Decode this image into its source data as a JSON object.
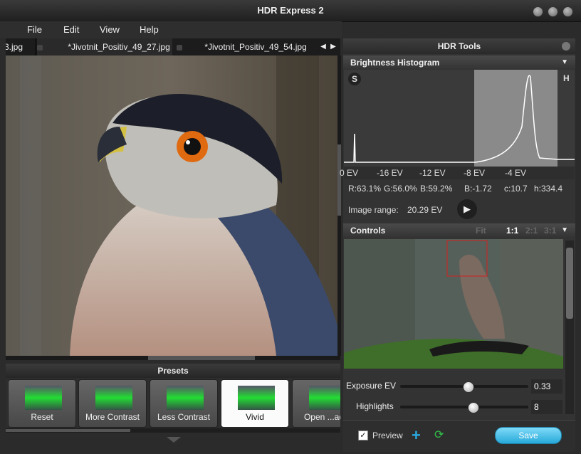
{
  "window": {
    "title": "HDR Express 2"
  },
  "menu": [
    "File",
    "Edit",
    "View",
    "Help"
  ],
  "tabs": [
    "3.jpg",
    "*Jivotnit_Positiv_49_27.jpg",
    "*Jivotnit_Positiv_49_54.jpg"
  ],
  "presets": {
    "header": "Presets",
    "items": [
      "Reset",
      "More Contrast",
      "Less Contrast",
      "Vivid",
      "Open ...adc"
    ],
    "selected": "Vivid"
  },
  "panel": {
    "title": "HDR Tools",
    "histogram": {
      "title": "Brightness Histogram",
      "s_label": "S",
      "h_label": "H",
      "ev_ticks": [
        "0 EV",
        "-16 EV",
        "-12 EV",
        "-8 EV",
        "-4 EV"
      ],
      "r": "R:63.1%",
      "g": "G:56.0%",
      "b": "B:59.2%",
      "bval": "B:-1.72",
      "c": "c:10.7",
      "h": "h:334.4",
      "range_label": "Image range:",
      "range_value": "20.29 EV"
    },
    "controls": {
      "title": "Controls",
      "zoom_options": [
        "Fit",
        "1:1",
        "2:1",
        "3:1"
      ],
      "zoom_selected": "1:1",
      "sliders": [
        {
          "label": "Exposure EV",
          "value": "0.33",
          "fraction": 0.55
        },
        {
          "label": "Highlights",
          "value": "8",
          "fraction": 0.55
        }
      ]
    },
    "footer": {
      "preview_label": "Preview",
      "preview_checked": true,
      "save_label": "Save"
    }
  },
  "colors": {
    "accent": "#27a9d9",
    "selection_box": "#d12020"
  }
}
